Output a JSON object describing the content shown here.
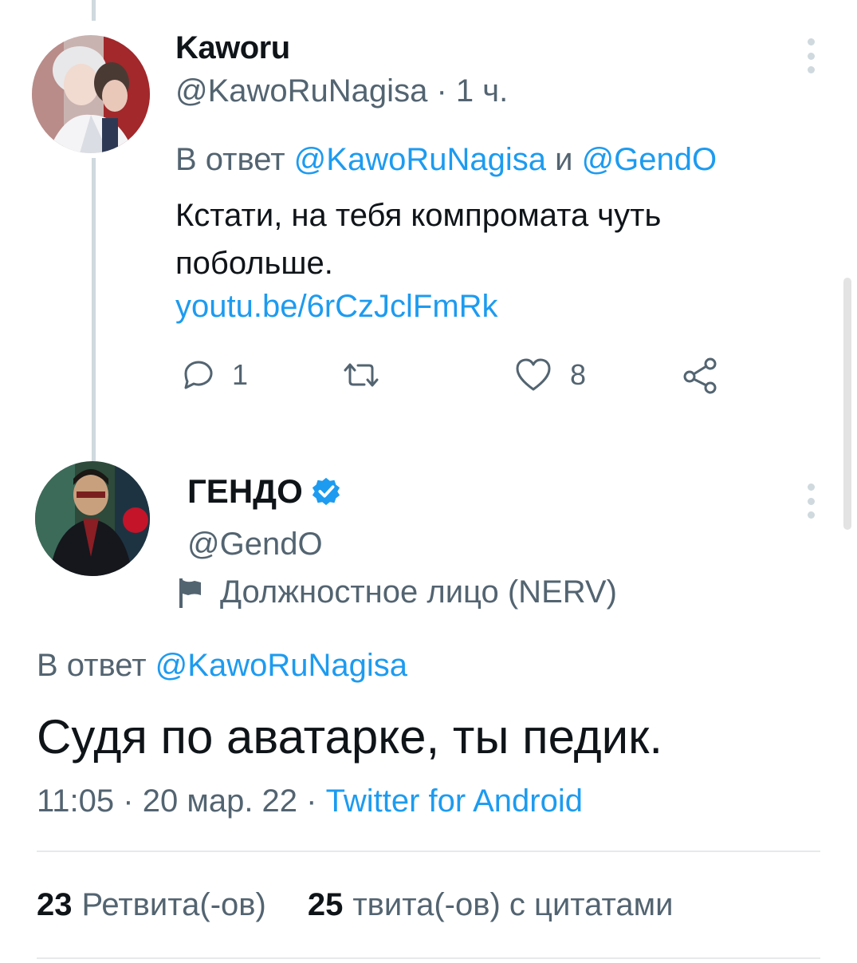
{
  "tweet1": {
    "name": "Kaworu",
    "handle": "@KawoRuNagisa",
    "separator": "·",
    "time": "1 ч.",
    "reply_prefix": "В ответ",
    "reply_user1": "@KawoRuNagisa",
    "reply_and": "и",
    "reply_user2": "@GendO",
    "text": "Кстати, на тебя компромата чуть побольше.",
    "url": "youtu.be/6rCzJclFmRk",
    "reply_count": "1",
    "retweet_count": "",
    "like_count": "8"
  },
  "tweet2": {
    "name": "ГЕНДО",
    "handle": "@GendO",
    "label": "Должностное лицо (NERV)",
    "reply_prefix": "В ответ",
    "reply_user": "@KawoRuNagisa",
    "text": "Судя по аватарке, ты педик.",
    "time": "11:05",
    "sep": "·",
    "date": "20 мар. 22",
    "client": "Twitter for Android",
    "retweets_num": "23",
    "retweets_label": "Ретвита(-ов)",
    "quotes_num": "25",
    "quotes_label": "твита(-ов) с цитатами"
  },
  "colors": {
    "link": "#1d9bf0",
    "secondary": "#536471",
    "thread_line": "#cfd9de",
    "text": "#0f1419"
  },
  "icons": [
    "reply-icon",
    "retweet-icon",
    "like-icon",
    "share-icon",
    "more-icon",
    "verified-badge-icon",
    "flag-icon"
  ]
}
